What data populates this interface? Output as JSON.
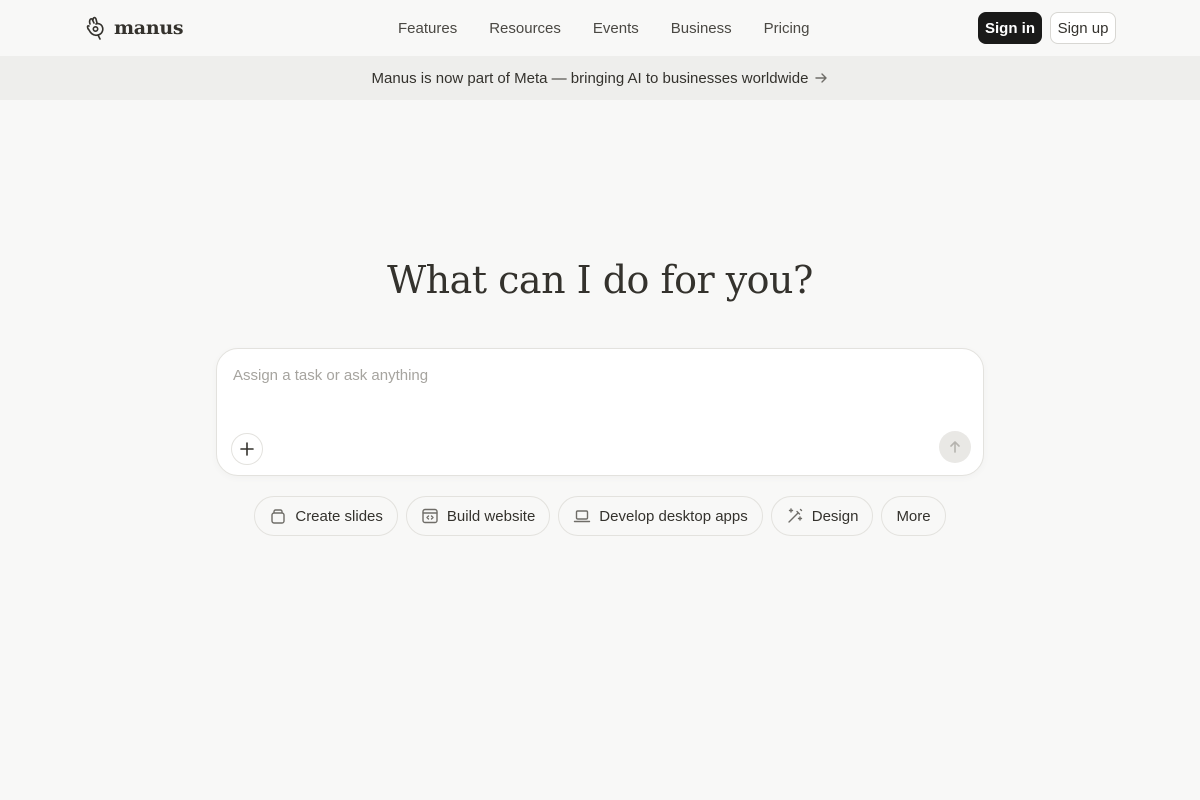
{
  "header": {
    "logo_text": "manus",
    "nav": [
      {
        "label": "Features"
      },
      {
        "label": "Resources"
      },
      {
        "label": "Events"
      },
      {
        "label": "Business"
      },
      {
        "label": "Pricing"
      }
    ],
    "sign_in_label": "Sign in",
    "sign_up_label": "Sign up"
  },
  "banner": {
    "text": "Manus is now part of Meta — bringing AI to businesses worldwide",
    "icon": "arrow-right-icon"
  },
  "hero": {
    "title": "What can I do for you?"
  },
  "composer": {
    "placeholder": "Assign a task or ask anything",
    "value": "",
    "attach_icon": "plus-icon",
    "send_icon": "arrow-up-icon"
  },
  "quick_actions": [
    {
      "label": "Create slides",
      "icon": "slides-icon"
    },
    {
      "label": "Build website",
      "icon": "browser-code-icon"
    },
    {
      "label": "Develop desktop apps",
      "icon": "laptop-icon"
    },
    {
      "label": "Design",
      "icon": "magic-wand-icon"
    },
    {
      "label": "More"
    }
  ],
  "colors": {
    "background": "#f8f8f7",
    "banner_background": "#eeeeec",
    "primary_button": "#1a1a19",
    "text": "#34322d",
    "placeholder": "#a6a49f"
  }
}
